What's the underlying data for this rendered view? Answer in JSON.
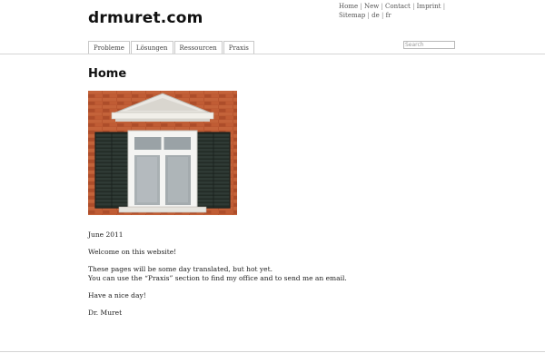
{
  "header": {
    "title": "drmuret.com"
  },
  "toplinks": {
    "home": "Home",
    "new": "New",
    "contact": "Contact",
    "imprint": "Imprint",
    "sitemap": "Sitemap",
    "de": "de",
    "fr": "fr",
    "separator": "|"
  },
  "nav": {
    "tabs": [
      "Probleme",
      "Lösungen",
      "Ressourcen",
      "Praxis"
    ]
  },
  "search": {
    "placeholder": "Search"
  },
  "main": {
    "heading": "Home",
    "date": "June 2011",
    "welcome": "Welcome on this website!",
    "line1": "These pages will be some day translated, but hot yet.",
    "line2": "You can use the “Praxis” section to find my office and to send me an email.",
    "closing": "Have a nice day!",
    "signature": "Dr. Muret"
  },
  "colors": {
    "brick": "#b8552f",
    "shutter": "#2f3a35",
    "frame": "#f2f2f0"
  }
}
